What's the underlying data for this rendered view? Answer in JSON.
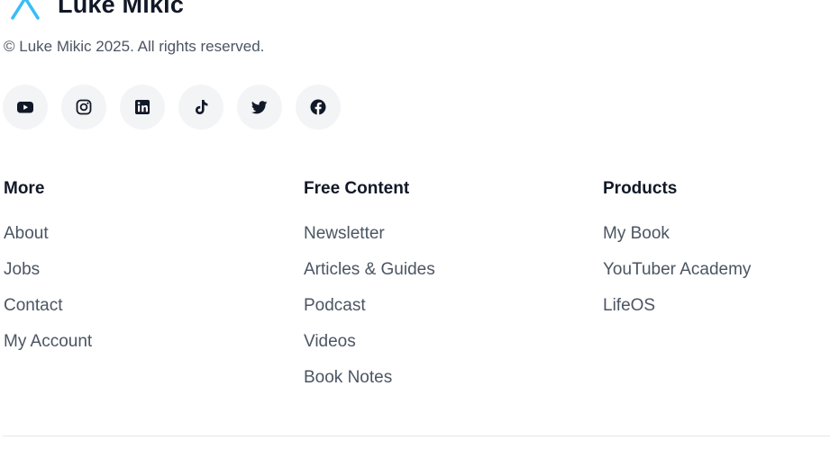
{
  "brand": {
    "name": "Luke Mikic",
    "logo_icon": "x-chevron-logo-icon",
    "accent_color": "#38bdf8"
  },
  "copyright": "© Luke Mikic 2025. All rights reserved.",
  "socials": [
    {
      "icon": "youtube-icon"
    },
    {
      "icon": "instagram-icon"
    },
    {
      "icon": "linkedin-icon"
    },
    {
      "icon": "tiktok-icon"
    },
    {
      "icon": "twitter-icon"
    },
    {
      "icon": "facebook-icon"
    }
  ],
  "columns": {
    "more": {
      "heading": "More",
      "links": [
        "About",
        "Jobs",
        "Contact",
        "My Account"
      ]
    },
    "free_content": {
      "heading": "Free Content",
      "links": [
        "Newsletter",
        "Articles & Guides",
        "Podcast",
        "Videos",
        "Book Notes"
      ]
    },
    "products": {
      "heading": "Products",
      "links": [
        "My Book",
        "YouTuber Academy",
        "LifeOS"
      ]
    }
  },
  "colors": {
    "social_bg": "#f3f4f6",
    "heading": "#111827",
    "link": "#4b5563",
    "divider": "#e5e7eb"
  }
}
